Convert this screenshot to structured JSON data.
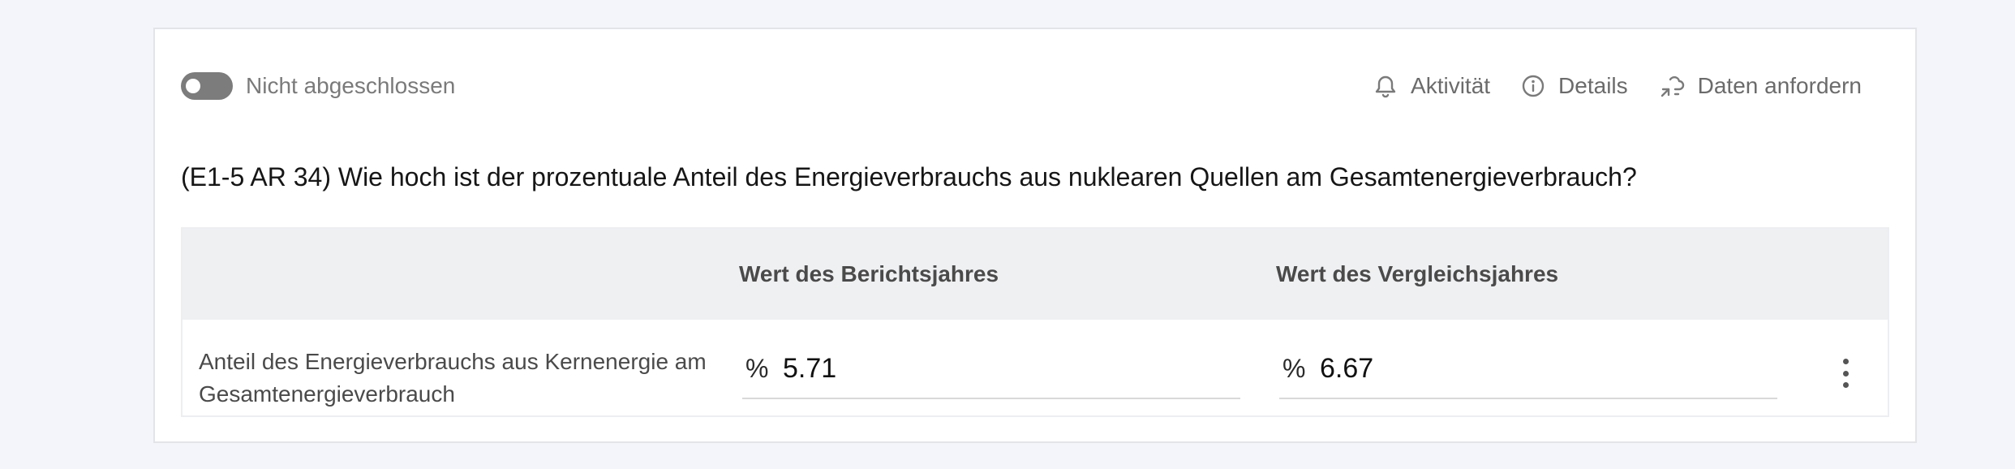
{
  "status": {
    "label": "Nicht abgeschlossen",
    "checked": false
  },
  "actions": [
    {
      "label": "Aktivität",
      "icon": "bell-icon"
    },
    {
      "label": "Details",
      "icon": "info-icon"
    },
    {
      "label": "Daten anfordern",
      "icon": "request-data-icon"
    }
  ],
  "question": "(E1-5 AR 34) Wie hoch ist der prozentuale Anteil des Energieverbrauchs aus nuklearen Quellen am Gesamtenergieverbrauch?",
  "table": {
    "headers": [
      "",
      "Wert des Berichtsjahres",
      "Wert des Vergleichsjahres"
    ],
    "rows": [
      {
        "label": "Anteil des Energieverbrauchs aus Kernenergie am Gesamtenergieverbrauch",
        "reporting_year": {
          "unit": "%",
          "value": "5.71"
        },
        "comparison_year": {
          "unit": "%",
          "value": "6.67"
        },
        "menu_icon": "more-vertical-icon"
      }
    ]
  }
}
